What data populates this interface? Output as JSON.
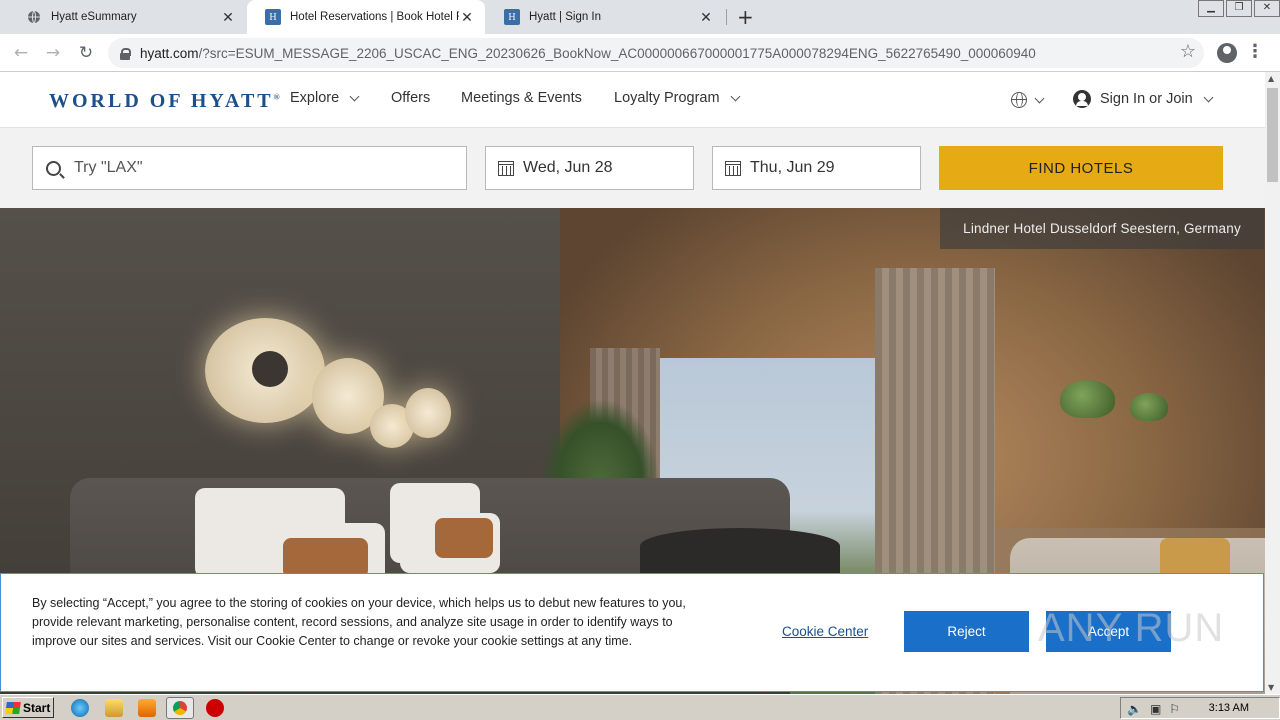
{
  "browser": {
    "tabs": [
      {
        "title": "Hyatt eSummary",
        "icon": "globe-icon",
        "active": false
      },
      {
        "title": "Hotel Reservations | Book Hotel Rooms",
        "icon": "hyatt-favicon",
        "active": true
      },
      {
        "title": "Hyatt | Sign In",
        "icon": "hyatt-favicon",
        "active": false
      }
    ],
    "url_domain": "hyatt.com",
    "url_path": "/?src=ESUM_MESSAGE_2206_USCAC_ENG_20230626_BookNow_AC000000667000001775A000078294ENG_5622765490_000060940"
  },
  "header": {
    "logo": "WORLD OF HYATT",
    "logo_mark": "®",
    "nav": [
      {
        "label": "Explore",
        "has_dropdown": true
      },
      {
        "label": "Offers",
        "has_dropdown": false
      },
      {
        "label": "Meetings & Events",
        "has_dropdown": false
      },
      {
        "label": "Loyalty Program",
        "has_dropdown": true
      }
    ],
    "sign_in": "Sign In or Join"
  },
  "search": {
    "destination_placeholder": "Try \"LAX\"",
    "checkin": "Wed, Jun 28",
    "checkout": "Thu, Jun 29",
    "button": "FIND HOTELS"
  },
  "hero": {
    "caption": "Lindner Hotel Dusseldorf Seestern, Germany"
  },
  "cookie_banner": {
    "text": "By selecting “Accept,” you agree to the storing of cookies on your device, which helps us to debut new features to you, provide relevant marketing, personalise content, record sessions, and analyze site usage in order to identify ways to improve our sites and services. Visit our Cookie Center to change or revoke your cookie settings at any time.",
    "cookie_center": "Cookie Center",
    "reject": "Reject",
    "accept": "Accept"
  },
  "watermark": "ANY RUN",
  "taskbar": {
    "start": "Start",
    "time": "3:13 AM"
  }
}
